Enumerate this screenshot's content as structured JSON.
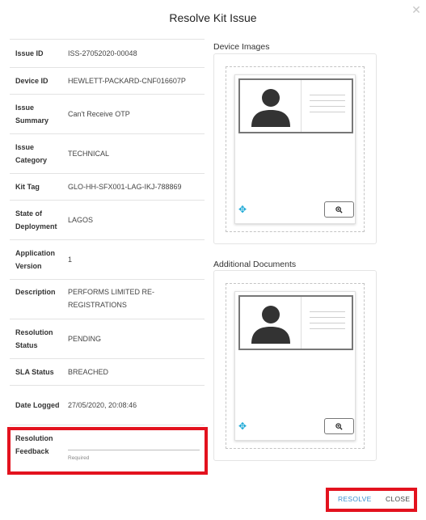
{
  "dialog": {
    "title": "Resolve Kit Issue",
    "close_icon": "close-icon"
  },
  "details": [
    {
      "label": "Issue ID",
      "value": "ISS-27052020-00048"
    },
    {
      "label": "Device ID",
      "value": "HEWLETT-PACKARD-CNF016607P"
    },
    {
      "label": "Issue Summary",
      "value": "Can't Receive OTP"
    },
    {
      "label": "Issue Category",
      "value": "TECHNICAL"
    },
    {
      "label": "Kit Tag",
      "value": "GLO-HH-SFX001-LAG-IKJ-788869"
    },
    {
      "label": "State of Deployment",
      "value": "LAGOS"
    },
    {
      "label": "Application Version",
      "value": "1"
    },
    {
      "label": "Description",
      "value": "PERFORMS LIMITED RE-REGISTRATIONS"
    },
    {
      "label": "Resolution Status",
      "value": "PENDING"
    },
    {
      "label": "SLA Status",
      "value": "BREACHED"
    },
    {
      "label": "Date Logged",
      "value": "27/05/2020, 20:08:46"
    }
  ],
  "feedback": {
    "label": "Resolution Feedback",
    "value": "",
    "hint": "Required"
  },
  "device_images": {
    "heading": "Device Images",
    "move_icon": "move-icon",
    "zoom_icon": "zoom-in-icon"
  },
  "additional_documents": {
    "heading": "Additional Documents",
    "move_icon": "move-icon",
    "zoom_icon": "zoom-in-icon"
  },
  "actions": {
    "resolve_label": "RESOLVE",
    "close_label": "CLOSE"
  },
  "colors": {
    "accent": "#3a8fd0",
    "highlight": "#e3121e",
    "move_icon": "#1aa8d6"
  }
}
